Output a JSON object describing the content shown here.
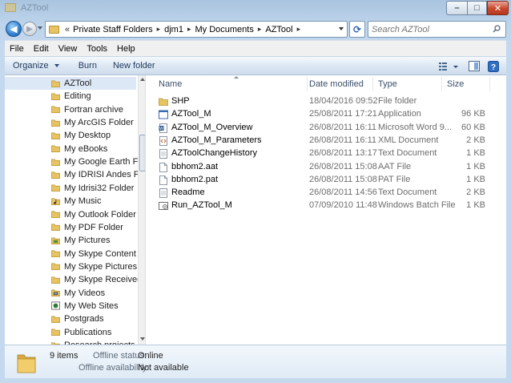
{
  "window": {
    "title": "AZTool",
    "buttons": {
      "minimize": "–",
      "maximize": "□",
      "close": "✕"
    }
  },
  "address_bar": {
    "overflow": "«",
    "breadcrumbs": [
      "Private Staff Folders",
      "djm1",
      "My Documents",
      "AZTool"
    ],
    "separator": "▸"
  },
  "search": {
    "placeholder": "Search AZTool"
  },
  "menu": [
    "File",
    "Edit",
    "View",
    "Tools",
    "Help"
  ],
  "toolbar": {
    "organize": "Organize",
    "burn": "Burn",
    "new_folder": "New folder"
  },
  "nav_pane": {
    "items": [
      {
        "label": "AZTool",
        "icon": "folder-icon",
        "selected": true
      },
      {
        "label": "Editing",
        "icon": "folder-icon"
      },
      {
        "label": "Fortran archive",
        "icon": "folder-icon"
      },
      {
        "label": "My ArcGIS Folder",
        "icon": "folder-icon"
      },
      {
        "label": "My Desktop",
        "icon": "folder-icon"
      },
      {
        "label": "My eBooks",
        "icon": "folder-icon"
      },
      {
        "label": "My Google Earth Folder",
        "icon": "folder-icon"
      },
      {
        "label": "My IDRISI Andes Folder",
        "icon": "folder-icon"
      },
      {
        "label": "My Idrisi32 Folder",
        "icon": "folder-icon"
      },
      {
        "label": "My Music",
        "icon": "music-folder-icon"
      },
      {
        "label": "My Outlook Folder",
        "icon": "folder-icon"
      },
      {
        "label": "My PDF Folder",
        "icon": "folder-icon"
      },
      {
        "label": "My Pictures",
        "icon": "pictures-folder-icon"
      },
      {
        "label": "My Skype Content",
        "icon": "folder-icon"
      },
      {
        "label": "My Skype Pictures",
        "icon": "folder-icon"
      },
      {
        "label": "My Skype Received Files",
        "icon": "folder-icon"
      },
      {
        "label": "My Videos",
        "icon": "videos-folder-icon"
      },
      {
        "label": "My Web Sites",
        "icon": "web-folder-icon"
      },
      {
        "label": "Postgrads",
        "icon": "folder-icon"
      },
      {
        "label": "Publications",
        "icon": "folder-icon"
      },
      {
        "label": "Research projects",
        "icon": "folder-icon"
      }
    ]
  },
  "file_list": {
    "columns": {
      "name": "Name",
      "date": "Date modified",
      "type": "Type",
      "size": "Size"
    },
    "files": [
      {
        "name": "SHP",
        "date": "18/04/2016 09:52",
        "type": "File folder",
        "size": "",
        "icon": "folder-icon"
      },
      {
        "name": "AZTool_M",
        "date": "25/08/2011 17:21",
        "type": "Application",
        "size": "96 KB",
        "icon": "application-icon"
      },
      {
        "name": "AZTool_M_Overview",
        "date": "26/08/2011 16:11",
        "type": "Microsoft Word 9...",
        "size": "60 KB",
        "icon": "word-document-icon"
      },
      {
        "name": "AZTool_M_Parameters",
        "date": "26/08/2011 16:11",
        "type": "XML Document",
        "size": "2 KB",
        "icon": "xml-document-icon"
      },
      {
        "name": "AZToolChangeHistory",
        "date": "26/08/2011 13:17",
        "type": "Text Document",
        "size": "1 KB",
        "icon": "text-document-icon"
      },
      {
        "name": "bbhom2.aat",
        "date": "26/08/2011 15:08",
        "type": "AAT File",
        "size": "1 KB",
        "icon": "file-icon"
      },
      {
        "name": "bbhom2.pat",
        "date": "26/08/2011 15:08",
        "type": "PAT File",
        "size": "1 KB",
        "icon": "file-icon"
      },
      {
        "name": "Readme",
        "date": "26/08/2011 14:56",
        "type": "Text Document",
        "size": "2 KB",
        "icon": "text-document-icon"
      },
      {
        "name": "Run_AZTool_M",
        "date": "07/09/2010 11:48",
        "type": "Windows Batch File",
        "size": "1 KB",
        "icon": "batch-file-icon"
      }
    ]
  },
  "details_pane": {
    "count": "9 items",
    "offline_status_label": "Offline status:",
    "offline_status_value": "Online",
    "offline_availability_label": "Offline availability:",
    "offline_availability_value": "Not available"
  },
  "colors": {
    "frame": "#bcd3ea",
    "selection": "#dde8f6",
    "folder": "#e8c362",
    "close": "#c9472b"
  }
}
